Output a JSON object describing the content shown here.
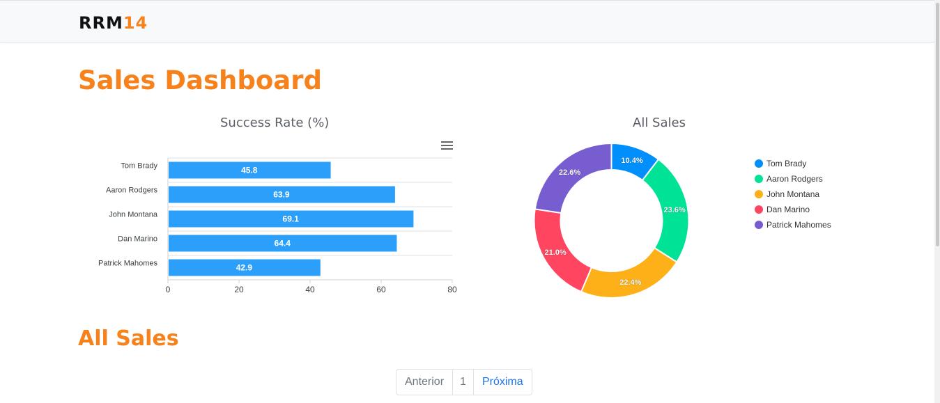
{
  "navbar": {
    "brand_part1": "RRM",
    "brand_part2": "14"
  },
  "page": {
    "title": "Sales Dashboard",
    "section_title": "All Sales"
  },
  "colors": {
    "accent": "#f7821b",
    "bar": "#2b9ffa"
  },
  "chart_data": [
    {
      "type": "bar",
      "orientation": "horizontal",
      "title": "Success Rate (%)",
      "categories": [
        "Tom Brady",
        "Aaron Rodgers",
        "John Montana",
        "Dan Marino",
        "Patrick Mahomes"
      ],
      "values": [
        45.8,
        63.9,
        69.1,
        64.4,
        42.9
      ],
      "data_labels": [
        "45.8",
        "63.9",
        "69.1",
        "64.4",
        "42.9"
      ],
      "xlim": [
        0,
        80
      ],
      "xticks": [
        "0",
        "20",
        "40",
        "60",
        "80"
      ],
      "grid": true,
      "color": "#2b9ffa"
    },
    {
      "type": "pie",
      "donut": true,
      "title": "All Sales",
      "labels": [
        "Tom Brady",
        "Aaron Rodgers",
        "John Montana",
        "Dan Marino",
        "Patrick Mahomes"
      ],
      "values": [
        10.4,
        23.6,
        22.4,
        21.0,
        22.6
      ],
      "data_labels": [
        "10.4%",
        "23.6%",
        "22.4%",
        "21.0%",
        "22.6%"
      ],
      "colors": [
        "#008ffb",
        "#00e396",
        "#feb019",
        "#ff4560",
        "#775dd0"
      ],
      "legend": "right"
    }
  ],
  "pagination": {
    "prev_label": "Anterior",
    "page_label": "1",
    "next_label": "Próxima"
  }
}
